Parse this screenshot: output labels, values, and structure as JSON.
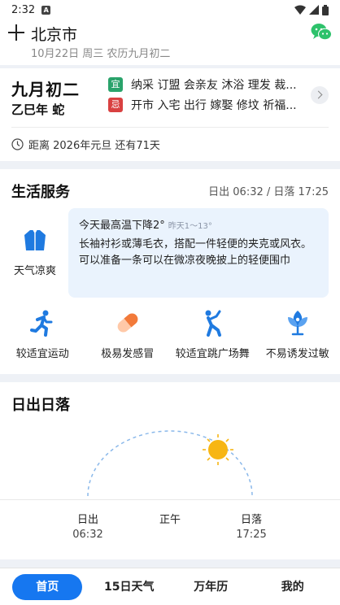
{
  "status": {
    "time": "2:32",
    "notif": "A"
  },
  "header": {
    "city": "北京市",
    "date": "10月22日 周三 农历九月初二"
  },
  "almanac": {
    "lunar_date": "九月初二",
    "ganzhi": "乙巳年 蛇",
    "yi_label": "宜",
    "yi": "纳采 订盟 会亲友 沐浴 理发 裁...",
    "ji_label": "忌",
    "ji": "开市 入宅 出行 嫁娶 修坟 祈福...",
    "countdown": "距离 2026年元旦 还有71天"
  },
  "life": {
    "title": "生活服务",
    "sun_times": "日出 06:32 / 日落 17:25",
    "weather_label": "天气凉爽",
    "tip_head": "今天最高温下降2°",
    "tip_sub": "昨天1～13°",
    "tip_body": "长袖衬衫或薄毛衣，搭配一件轻便的夹克或风衣。可以准备一条可以在微凉夜晚披上的轻便围巾",
    "services": [
      {
        "icon": "running-icon",
        "label": "较适宜运动"
      },
      {
        "icon": "pill-icon",
        "label": "极易发感冒"
      },
      {
        "icon": "dance-icon",
        "label": "较适宜跳广场舞"
      },
      {
        "icon": "flower-icon",
        "label": "不易诱发过敏"
      }
    ]
  },
  "sunrise": {
    "title": "日出日落",
    "rise_label": "日出",
    "rise_time": "06:32",
    "noon_label": "正午",
    "set_label": "日落",
    "set_time": "17:25"
  },
  "tabs": [
    "首页",
    "15日天气",
    "万年历",
    "我的"
  ],
  "colors": {
    "accent": "#1677f0",
    "yi": "#2aa36b",
    "ji": "#d94141",
    "sun": "#f7b614"
  }
}
